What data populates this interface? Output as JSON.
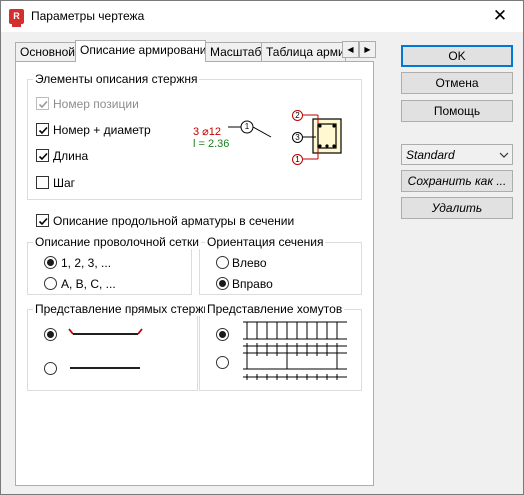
{
  "window": {
    "title": "Параметры чертежа",
    "close_glyph": "✕",
    "app_icon_letter": "R"
  },
  "tabs": [
    {
      "label": "Основной",
      "active": false
    },
    {
      "label": "Описание армирования",
      "active": true
    },
    {
      "label": "Масштаб",
      "active": false
    },
    {
      "label": "Таблица армир",
      "active": false
    }
  ],
  "tab_scroll": {
    "left": "◀",
    "right": "▶"
  },
  "rod_elements": {
    "title": "Элементы описания стержня",
    "items": [
      {
        "label": "Номер позиции",
        "checked": true,
        "enabled": false
      },
      {
        "label": "Номер + диаметр",
        "checked": true,
        "enabled": true
      },
      {
        "label": "Длина",
        "checked": true,
        "enabled": true
      },
      {
        "label": "Шаг",
        "checked": false,
        "enabled": true
      }
    ],
    "preview": {
      "diameter_text": "3 ⌀12",
      "length_text": "l = 2.36",
      "callout_number": "1",
      "section_callouts": [
        "2",
        "3",
        "1"
      ],
      "red_color": "#c00000",
      "green_color": "#1a7f1a"
    }
  },
  "longitudinal": {
    "label": "Описание продольной арматуры в сечении",
    "checked": true
  },
  "wire_mesh": {
    "title": "Описание проволочной сетки",
    "options": [
      {
        "label": "1, 2, 3, ...",
        "selected": true
      },
      {
        "label": "A, B, C, ...",
        "selected": false
      }
    ]
  },
  "orientation": {
    "title": "Ориентация сечения",
    "options": [
      {
        "label": "Влево",
        "selected": false
      },
      {
        "label": "Вправо",
        "selected": true
      }
    ]
  },
  "straight_rods": {
    "title": "Представление прямых стержней",
    "options": [
      {
        "selected": true
      },
      {
        "selected": false
      }
    ]
  },
  "stirrups": {
    "title": "Представление хомутов",
    "options": [
      {
        "selected": true
      },
      {
        "selected": false
      }
    ]
  },
  "buttons": {
    "ok": "OK",
    "cancel": "Отмена",
    "help": "Помощь",
    "save_as": "Сохранить как ...",
    "delete": "Удалить"
  },
  "style_select": {
    "value": "Standard"
  }
}
